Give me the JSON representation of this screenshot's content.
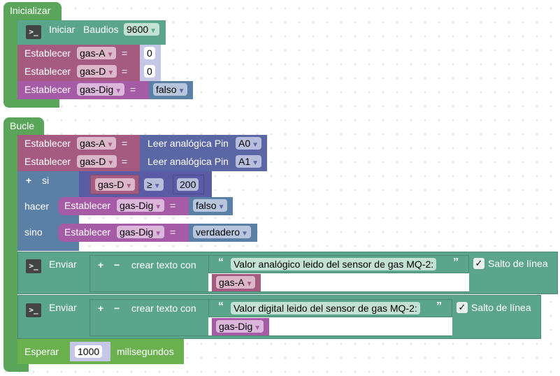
{
  "colors": {
    "event": "#5ba55b",
    "serial": "#5ba58c",
    "var_number": "#a55b80",
    "var_bool": "#a55ba5",
    "logic": "#5b80a5",
    "io": "#5b67a5"
  },
  "setup": {
    "title": "Inicializar",
    "serial_begin": {
      "label": "Iniciar",
      "baud_label": "Baudios",
      "baud": "9600",
      "icon": "terminal-icon"
    },
    "sets": [
      {
        "label": "Establecer",
        "var": "gas-A",
        "eq": "=",
        "value": "0"
      },
      {
        "label": "Establecer",
        "var": "gas-D",
        "eq": "=",
        "value": "0"
      },
      {
        "label": "Establecer",
        "var": "gas-Dig",
        "eq": "=",
        "value": "falso"
      }
    ]
  },
  "loop": {
    "title": "Bucle",
    "reads": [
      {
        "label": "Establecer",
        "var": "gas-A",
        "eq": "=",
        "read": "Leer analógica Pin",
        "pin": "A0"
      },
      {
        "label": "Establecer",
        "var": "gas-D",
        "eq": "=",
        "read": "Leer analógica Pin",
        "pin": "A1"
      }
    ],
    "if": {
      "plus": "+",
      "si": "si",
      "var": "gas-D",
      "op": "≥",
      "value": "200",
      "hacer": "hacer",
      "sino": "sino",
      "then": {
        "label": "Establecer",
        "var": "gas-Dig",
        "eq": "=",
        "value": "falso"
      },
      "else": {
        "label": "Establecer",
        "var": "gas-Dig",
        "eq": "=",
        "value": "verdadero"
      }
    },
    "prints": [
      {
        "label": "Enviar",
        "plus": "+",
        "minus": "−",
        "join": "crear texto con",
        "open_q": "“",
        "close_q": "”",
        "text": "Valor analógico leido del sensor de gas MQ-2:",
        "var": "gas-A",
        "newline_checked": "✓",
        "newline": "Salto de línea"
      },
      {
        "label": "Enviar",
        "plus": "+",
        "minus": "−",
        "join": "crear texto con",
        "open_q": "“",
        "close_q": "”",
        "text": "Valor digital leido del sensor de gas MQ-2:",
        "var": "gas-Dig",
        "newline_checked": "✓",
        "newline": "Salto de línea"
      }
    ],
    "delay": {
      "label": "Esperar",
      "value": "1000",
      "unit": "milisegundos"
    }
  }
}
